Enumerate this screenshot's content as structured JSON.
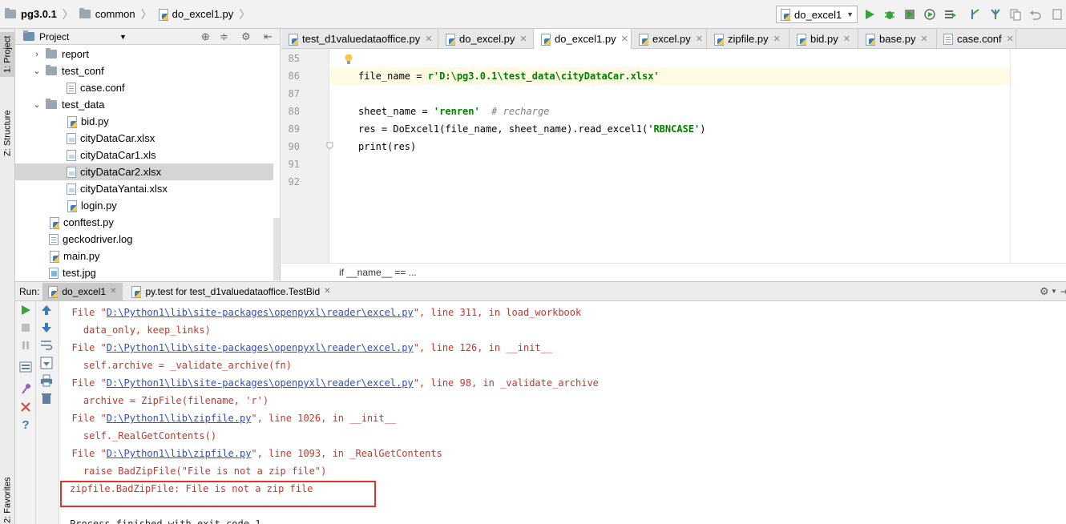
{
  "breadcrumb": {
    "project": "pg3.0.1",
    "folder": "common",
    "file": "do_excel1.py"
  },
  "run_config": {
    "selected": "do_excel1"
  },
  "left_strip": {
    "project_tab": "1: Project",
    "structure_tab": "Z: Structure",
    "favorites_tab": "2: Favorites"
  },
  "project_panel": {
    "title": "Project"
  },
  "tree": [
    {
      "label": "report",
      "kind": "folder",
      "arrow": "›"
    },
    {
      "label": "test_conf",
      "kind": "folder",
      "arrow": "⌄"
    },
    {
      "label": "case.conf",
      "kind": "conf"
    },
    {
      "label": "test_data",
      "kind": "folder",
      "arrow": "⌄"
    },
    {
      "label": "bid.py",
      "kind": "py"
    },
    {
      "label": "cityDataCar.xlsx",
      "kind": "xls"
    },
    {
      "label": "cityDataCar1.xls",
      "kind": "xls"
    },
    {
      "label": "cityDataCar2.xlsx",
      "kind": "xls"
    },
    {
      "label": "cityDataYantai.xlsx",
      "kind": "xls"
    },
    {
      "label": "login.py",
      "kind": "py"
    },
    {
      "label": "conftest.py",
      "kind": "py"
    },
    {
      "label": "geckodriver.log",
      "kind": "conf"
    },
    {
      "label": "main.py",
      "kind": "py"
    },
    {
      "label": "test.jpg",
      "kind": "img"
    }
  ],
  "editor_tabs": [
    {
      "label": "test_d1valuedataoffice.py"
    },
    {
      "label": "do_excel.py"
    },
    {
      "label": "do_excel1.py"
    },
    {
      "label": "excel.py"
    },
    {
      "label": "zipfile.py"
    },
    {
      "label": "bid.py"
    },
    {
      "label": "base.py"
    },
    {
      "label": "case.conf"
    }
  ],
  "editor": {
    "line_numbers": [
      "85",
      "86",
      "87",
      "88",
      "89",
      "90",
      "91",
      "92"
    ],
    "line86": {
      "pre": "file_name = ",
      "str": "r'D:\\pg3.0.1\\test_data\\cityDataCar.xlsx'"
    },
    "line88": {
      "pre": "sheet_name = ",
      "str": "'renren'",
      "comment": "  # recharge"
    },
    "line89": {
      "pre": "res = DoExcel1(file_name, sheet_name).read_excel1(",
      "str": "'RBNCASE'",
      "post": ")"
    },
    "line90": "print(res)",
    "breadcrumb": "if __name__ == ..."
  },
  "run_bar": {
    "label": "Run:",
    "tab_active": "do_excel1",
    "tab_other": "py.test for test_d1valuedataoffice.TestBid"
  },
  "console": {
    "l1": {
      "pre": "  File \"",
      "link": "D:\\Python1\\lib\\site-packages\\openpyxl\\reader\\excel.py",
      "post": "\", line 311, in load_workbook"
    },
    "l2": "    data_only, keep_links)",
    "l3": {
      "pre": "  File \"",
      "link": "D:\\Python1\\lib\\site-packages\\openpyxl\\reader\\excel.py",
      "post": "\", line 126, in __init__"
    },
    "l4": "    self.archive = _validate_archive(fn)",
    "l5": {
      "pre": "  File \"",
      "link": "D:\\Python1\\lib\\site-packages\\openpyxl\\reader\\excel.py",
      "post": "\", line 98, in _validate_archive"
    },
    "l6": "    archive = ZipFile(filename, 'r')",
    "l7": {
      "pre": "  File \"",
      "link": "D:\\Python1\\lib\\zipfile.py",
      "post": "\", line 1026, in __init__"
    },
    "l8": "    self._RealGetContents()",
    "l9": {
      "pre": "  File \"",
      "link": "D:\\Python1\\lib\\zipfile.py",
      "post": "\", line 1093, in _RealGetContents"
    },
    "l10": "    raise BadZipFile(\"File is not a zip file\")",
    "l11": "zipfile.BadZipFile: File is not a zip file",
    "l12": "Process finished with exit code 1"
  }
}
